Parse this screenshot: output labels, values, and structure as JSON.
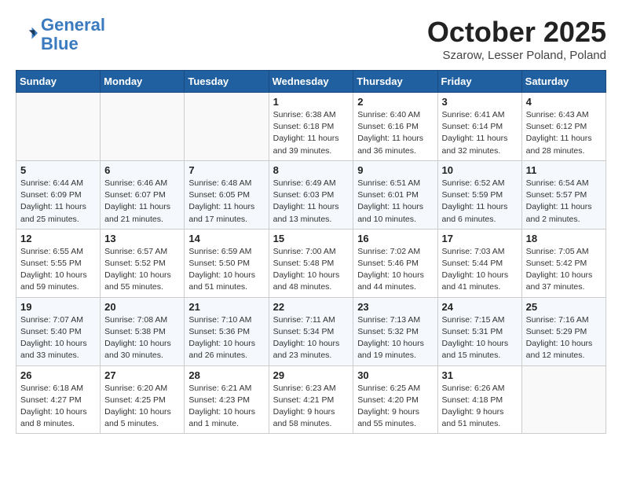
{
  "header": {
    "logo_line1": "General",
    "logo_line2": "Blue",
    "month": "October 2025",
    "location": "Szarow, Lesser Poland, Poland"
  },
  "weekdays": [
    "Sunday",
    "Monday",
    "Tuesday",
    "Wednesday",
    "Thursday",
    "Friday",
    "Saturday"
  ],
  "weeks": [
    [
      {
        "day": "",
        "info": ""
      },
      {
        "day": "",
        "info": ""
      },
      {
        "day": "",
        "info": ""
      },
      {
        "day": "1",
        "info": "Sunrise: 6:38 AM\nSunset: 6:18 PM\nDaylight: 11 hours\nand 39 minutes."
      },
      {
        "day": "2",
        "info": "Sunrise: 6:40 AM\nSunset: 6:16 PM\nDaylight: 11 hours\nand 36 minutes."
      },
      {
        "day": "3",
        "info": "Sunrise: 6:41 AM\nSunset: 6:14 PM\nDaylight: 11 hours\nand 32 minutes."
      },
      {
        "day": "4",
        "info": "Sunrise: 6:43 AM\nSunset: 6:12 PM\nDaylight: 11 hours\nand 28 minutes."
      }
    ],
    [
      {
        "day": "5",
        "info": "Sunrise: 6:44 AM\nSunset: 6:09 PM\nDaylight: 11 hours\nand 25 minutes."
      },
      {
        "day": "6",
        "info": "Sunrise: 6:46 AM\nSunset: 6:07 PM\nDaylight: 11 hours\nand 21 minutes."
      },
      {
        "day": "7",
        "info": "Sunrise: 6:48 AM\nSunset: 6:05 PM\nDaylight: 11 hours\nand 17 minutes."
      },
      {
        "day": "8",
        "info": "Sunrise: 6:49 AM\nSunset: 6:03 PM\nDaylight: 11 hours\nand 13 minutes."
      },
      {
        "day": "9",
        "info": "Sunrise: 6:51 AM\nSunset: 6:01 PM\nDaylight: 11 hours\nand 10 minutes."
      },
      {
        "day": "10",
        "info": "Sunrise: 6:52 AM\nSunset: 5:59 PM\nDaylight: 11 hours\nand 6 minutes."
      },
      {
        "day": "11",
        "info": "Sunrise: 6:54 AM\nSunset: 5:57 PM\nDaylight: 11 hours\nand 2 minutes."
      }
    ],
    [
      {
        "day": "12",
        "info": "Sunrise: 6:55 AM\nSunset: 5:55 PM\nDaylight: 10 hours\nand 59 minutes."
      },
      {
        "day": "13",
        "info": "Sunrise: 6:57 AM\nSunset: 5:52 PM\nDaylight: 10 hours\nand 55 minutes."
      },
      {
        "day": "14",
        "info": "Sunrise: 6:59 AM\nSunset: 5:50 PM\nDaylight: 10 hours\nand 51 minutes."
      },
      {
        "day": "15",
        "info": "Sunrise: 7:00 AM\nSunset: 5:48 PM\nDaylight: 10 hours\nand 48 minutes."
      },
      {
        "day": "16",
        "info": "Sunrise: 7:02 AM\nSunset: 5:46 PM\nDaylight: 10 hours\nand 44 minutes."
      },
      {
        "day": "17",
        "info": "Sunrise: 7:03 AM\nSunset: 5:44 PM\nDaylight: 10 hours\nand 41 minutes."
      },
      {
        "day": "18",
        "info": "Sunrise: 7:05 AM\nSunset: 5:42 PM\nDaylight: 10 hours\nand 37 minutes."
      }
    ],
    [
      {
        "day": "19",
        "info": "Sunrise: 7:07 AM\nSunset: 5:40 PM\nDaylight: 10 hours\nand 33 minutes."
      },
      {
        "day": "20",
        "info": "Sunrise: 7:08 AM\nSunset: 5:38 PM\nDaylight: 10 hours\nand 30 minutes."
      },
      {
        "day": "21",
        "info": "Sunrise: 7:10 AM\nSunset: 5:36 PM\nDaylight: 10 hours\nand 26 minutes."
      },
      {
        "day": "22",
        "info": "Sunrise: 7:11 AM\nSunset: 5:34 PM\nDaylight: 10 hours\nand 23 minutes."
      },
      {
        "day": "23",
        "info": "Sunrise: 7:13 AM\nSunset: 5:32 PM\nDaylight: 10 hours\nand 19 minutes."
      },
      {
        "day": "24",
        "info": "Sunrise: 7:15 AM\nSunset: 5:31 PM\nDaylight: 10 hours\nand 15 minutes."
      },
      {
        "day": "25",
        "info": "Sunrise: 7:16 AM\nSunset: 5:29 PM\nDaylight: 10 hours\nand 12 minutes."
      }
    ],
    [
      {
        "day": "26",
        "info": "Sunrise: 6:18 AM\nSunset: 4:27 PM\nDaylight: 10 hours\nand 8 minutes."
      },
      {
        "day": "27",
        "info": "Sunrise: 6:20 AM\nSunset: 4:25 PM\nDaylight: 10 hours\nand 5 minutes."
      },
      {
        "day": "28",
        "info": "Sunrise: 6:21 AM\nSunset: 4:23 PM\nDaylight: 10 hours\nand 1 minute."
      },
      {
        "day": "29",
        "info": "Sunrise: 6:23 AM\nSunset: 4:21 PM\nDaylight: 9 hours\nand 58 minutes."
      },
      {
        "day": "30",
        "info": "Sunrise: 6:25 AM\nSunset: 4:20 PM\nDaylight: 9 hours\nand 55 minutes."
      },
      {
        "day": "31",
        "info": "Sunrise: 6:26 AM\nSunset: 4:18 PM\nDaylight: 9 hours\nand 51 minutes."
      },
      {
        "day": "",
        "info": ""
      }
    ]
  ]
}
